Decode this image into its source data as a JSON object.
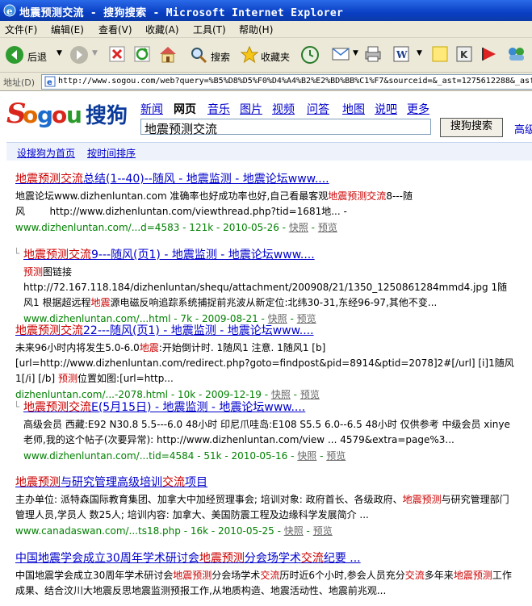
{
  "window": {
    "title": "地震预测交流 - 搜狗搜索 - Microsoft Internet Explorer"
  },
  "menu": [
    "文件(F)",
    "编辑(E)",
    "查看(V)",
    "收藏(A)",
    "工具(T)",
    "帮助(H)"
  ],
  "toolbar": {
    "back": "后退",
    "search": "搜索",
    "favorites": "收藏夹"
  },
  "address": {
    "label": "地址(D)",
    "url": "http://www.sogou.com/web?query=%B5%D8%D5%F0%D4%A4%B2%E2%BD%BB%C1%F7&sourceid=&_ast=1275612288&_asf"
  },
  "sogou": {
    "logo_text": "Sogou",
    "logo_cn": "搜狗",
    "nav": [
      "新闻",
      "网页",
      "音乐",
      "图片",
      "视频",
      "问答",
      "地图",
      "说吧",
      "更多"
    ],
    "query": "地震预测交流",
    "search_button": "搜狗搜索",
    "advanced": "高级",
    "set_home": "设搜狗为首页",
    "sort_time": "按时间排序"
  },
  "results": [
    {
      "title_html": "<em>地震预测交流</em>总结(1--40)--随风 - 地震监测 - 地震论坛www....",
      "snippet_html": "地震论坛www.dizhenluntan.com 准确率也好成功率也好,自己看最客观<em>地震预测交流</em>8---随风&nbsp;&nbsp;&nbsp;&nbsp;&nbsp;&nbsp;&nbsp;&nbsp;http://www.dizhenluntan.com/viewthread.php?tid=1681地... -",
      "url": "www.dizhenluntan.com/...d=4583 - 121k - 2010-05-26 - ",
      "snapshot": "快照",
      "preview": "预览"
    },
    {
      "title_html": "<em>地震预测交流</em>9---随风(页1) - 地震监测 - 地震论坛www....",
      "snippet_html": "<em>预测</em>图链接http://72.167.118.184/dizhenluntan/shequ/attachment/200908/21/1350_1250861284mmd4.jpg 1随风1 根据超远程<em>地震</em>源电磁反响追踪系统捕捉前兆波从新定位:北纬30-31,东经96-97,其他不变...",
      "url": "www.dizhenluntan.com/...html - 7k - 2009-08-21 - ",
      "snapshot": "快照",
      "preview": "预览"
    },
    {
      "title_html": "<em>地震预测交流</em>22---随风(页1) - 地震监测 - 地震论坛www....",
      "snippet_html": "未来96小时内将发生5.0-6.0<em>地震</em>:开始倒计时. 1随风1 注意. 1随风1 [b] [url=http://www.dizhenluntan.com/redirect.php?goto=findpost&amp;pid=8914&amp;ptid=2078]2#[/url] [i]1随风1[/i] [/b] <em>预测</em>位置如图:[url=http...",
      "url": "dizhenluntan.com/...-2078.html - 10k - 2009-12-19 - ",
      "snapshot": "快照",
      "preview": "预览"
    },
    {
      "title_html": "<em>地震预测交流</em>E(5月15日) - 地震监测 - 地震论坛www....",
      "snippet_html": "高级会员 西藏:E92 N30.8 5.5---6.0 48小时 印尼爪哇岛:E108 S5.5 6.0--6.5 48小时 仅供参考 中级会员 xinye老师,我的这个帖子(次要异常): http://www.dizhenluntan.com/view ... 4579&amp;extra=page%3...",
      "url": "www.dizhenluntan.com/...tid=4584 - 51k - 2010-05-16 - ",
      "snapshot": "快照",
      "preview": "预览"
    },
    {
      "title_html": "<em>地震预测</em>与研究管理高级培训<em>交流</em>项目",
      "snippet_html": "主办单位: 派特森国际教育集团、加拿大中加经贸理事会; 培训对象: 政府首长、各级政府、<em>地震预测</em>与研究管理部门管理人员,学员人 数25人; 培训内容: 加拿大、美国防震工程及边缘科学发展简介 ...",
      "url": "www.canadaswan.com/...ts18.php - 16k - 2010-05-25 - ",
      "snapshot": "快照",
      "preview": "预览"
    },
    {
      "title_html": "中国地震学会成立30周年学术研讨会<em>地震预测</em>分会场学术<em>交流</em>纪要 ...",
      "snippet_html": "中国地震学会成立30周年学术研讨会<em>地震预测</em>分会场学术<em>交流</em>历时近6个小时,参会人员充分<em>交流</em>多年来<em>地震预测</em>工作成果、结合汶川大地震反思地震监测预报工作,从地质构造、地震活动性、地震前兆观...",
      "url": "",
      "snapshot": "",
      "preview": ""
    }
  ]
}
